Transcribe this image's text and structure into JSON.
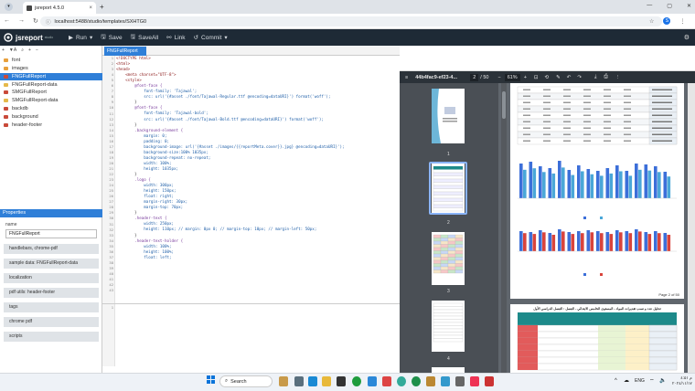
{
  "browser": {
    "tab_title": "jsreport 4.5.0",
    "url": "localhost:5488/studio/templates/SXHTG0",
    "new_tab": "+",
    "avatar_letter": "S"
  },
  "toolbar": {
    "logo": "jsreport",
    "logo_sub": "studio",
    "run": "Run",
    "save": "Save",
    "saveall": "SaveAll",
    "link": "Link",
    "commit": "Commit"
  },
  "tree": [
    {
      "label": "font",
      "type": "folder"
    },
    {
      "label": "images",
      "type": "folder"
    },
    {
      "label": "FNGFullReport",
      "type": "template",
      "selected": true
    },
    {
      "label": "FNGFullReport-data",
      "type": "data"
    },
    {
      "label": "SMGFullReport",
      "type": "template"
    },
    {
      "label": "SMGFullReport-data",
      "type": "data"
    },
    {
      "label": "backdb",
      "type": "template"
    },
    {
      "label": "background",
      "type": "template"
    },
    {
      "label": "header-footer",
      "type": "template"
    }
  ],
  "properties": {
    "title": "Properties",
    "name_label": "name",
    "name_value": "FNGFullReport",
    "buttons": [
      "handlebars, chrome-pdf",
      "sample data: FNGFullReport-data",
      "localization",
      "pdf utils: header-footer",
      "tags",
      "chrome pdf",
      "scripts"
    ]
  },
  "editor": {
    "tab": "FNGFullReport",
    "lines": [
      "<!DOCTYPE html>",
      "<html>",
      "",
      "<head>",
      "    <meta charset=\"UTF-8\">",
      "    <style>",
      "        @font-face {",
      "            font-family: 'Tajawal';",
      "            src: url('{#asset ./font/Tajawal-Regular.ttf @encoding=dataURI}') format('woff');",
      "        }",
      "",
      "        @font-face {",
      "            font-family: 'Tajawal-bold';",
      "            src: url('{#asset ./font/Tajawal-Bold.ttf @encoding=dataURI}') format('woff');",
      "        }",
      "",
      "        .background-element {",
      "            margin: 0;",
      "            padding: 0;",
      "            background-image: url('{#asset ./images/{{reportMeta.cover}}.jpg} @encoding=dataURI}');",
      "            background-size:100% 1035px;",
      "            background-repeat: no-repeat;",
      "            width: 100%;",
      "            height: 1035px;",
      "        }",
      "",
      "        .logo {",
      "            width: 300px;",
      "            height: 150px;",
      "            float: right;",
      "            margin-right: 30px;",
      "            margin-top: 70px;",
      "        }",
      "",
      "        .header-text {",
      "            width: 250px;",
      "            height: 110px; // margin: 0px 0; // margin-top: 10px; // margin-left: 50px;",
      "        }",
      "",
      "        .header-text-holder {",
      "            width: 100%;",
      "            height: 100%;",
      "            float: left;"
    ],
    "bottom_line": "1"
  },
  "preview": {
    "tabs": [
      "report",
      "profile"
    ],
    "doc_name": "44b4fac9-ef23-4...",
    "page": "2",
    "page_total": "/ 50",
    "zoom": "61%",
    "thumb_numbers": [
      "1",
      "2",
      "3",
      "4"
    ],
    "page_footer": "Page 2 of 50",
    "page2_title": "تحليل عدد و نسب تقديرات المواد - المستوى الخامس الابتدائي - الفصل : الفصل الدراسي الأول"
  },
  "taskbar": {
    "search": "Search",
    "lang": "ENG",
    "time": "م ٤:٥١",
    "date": "٢٠٢٤/١١/١٧"
  },
  "colors": {
    "accent": "#2f7fd8",
    "toolbar": "#1e2a36",
    "bar_blue": "#3c6fd9",
    "bar_red": "#d9443c"
  }
}
